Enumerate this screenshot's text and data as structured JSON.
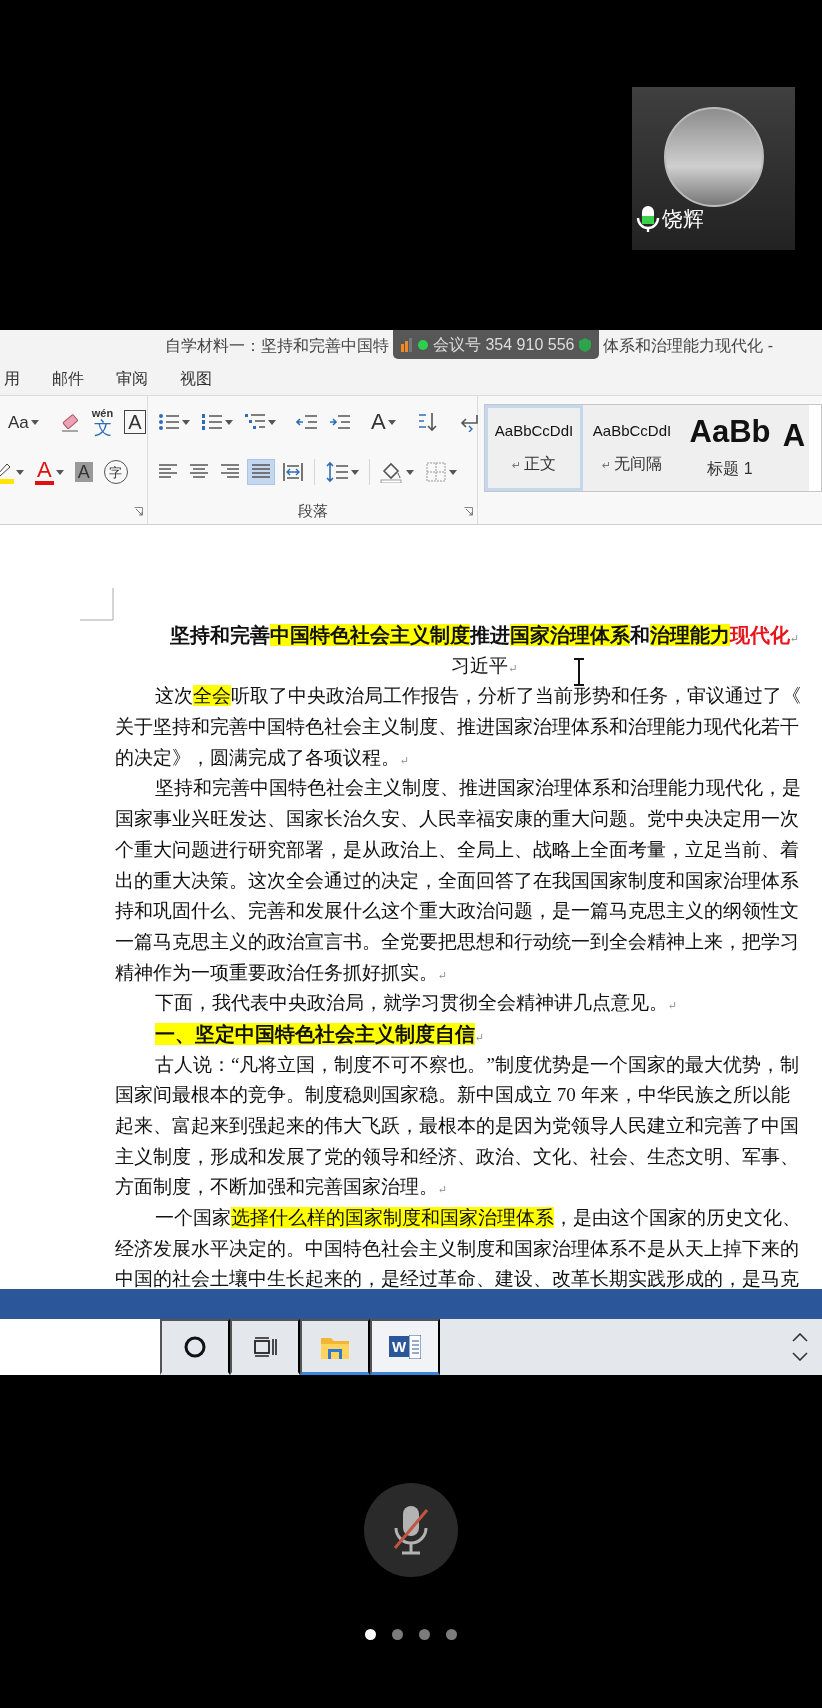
{
  "participant": {
    "name": "饶辉",
    "level": 0.5
  },
  "window": {
    "title_left": "自学材料一：坚持和完善中国特",
    "title_right": "体系和治理能力现代化 -"
  },
  "meeting_overlay": {
    "label": "会议号 354 910 556"
  },
  "menu_tabs": [
    {
      "label": "用"
    },
    {
      "label": "邮件"
    },
    {
      "label": "审阅"
    },
    {
      "label": "视图"
    }
  ],
  "font_group": {
    "row1": [
      {
        "kind": "font-size",
        "glyph": "Aa",
        "dropdown": true
      },
      {
        "kind": "separator"
      },
      {
        "kind": "eraser"
      },
      {
        "kind": "phonetic",
        "glyph": "文",
        "ruby": "wén"
      },
      {
        "kind": "boxed",
        "glyph": "A"
      }
    ],
    "row2": [
      {
        "kind": "highlighter",
        "dropdown": true
      },
      {
        "kind": "font-color",
        "glyph": "A",
        "dropdown": true
      },
      {
        "kind": "shaded",
        "glyph": "A"
      },
      {
        "kind": "circled",
        "glyph": "字"
      }
    ]
  },
  "paragraph_group": {
    "label": "段落",
    "row1": [
      {
        "kind": "bullets",
        "dropdown": true,
        "selected": false
      },
      {
        "kind": "numbering",
        "dropdown": true,
        "selected": false
      },
      {
        "kind": "multilevel",
        "dropdown": true,
        "selected": false
      },
      {
        "kind": "separator"
      },
      {
        "kind": "outdent",
        "selected": false
      },
      {
        "kind": "indent",
        "selected": false
      },
      {
        "kind": "separator"
      },
      {
        "kind": "asian-layout",
        "glyph": "A",
        "dropdown": true,
        "selected": false
      },
      {
        "kind": "separator"
      },
      {
        "kind": "sort",
        "selected": false
      },
      {
        "kind": "separator"
      },
      {
        "kind": "show-marks",
        "selected": false
      }
    ],
    "row2": [
      {
        "kind": "align-left",
        "selected": false
      },
      {
        "kind": "align-center",
        "selected": false
      },
      {
        "kind": "align-right",
        "selected": false
      },
      {
        "kind": "justify",
        "selected": true
      },
      {
        "kind": "distribute",
        "selected": false
      },
      {
        "kind": "separator"
      },
      {
        "kind": "line-spacing",
        "dropdown": true,
        "selected": false
      },
      {
        "kind": "separator"
      },
      {
        "kind": "shading",
        "dropdown": true,
        "selected": false
      },
      {
        "kind": "borders",
        "dropdown": true,
        "selected": false
      }
    ]
  },
  "styles": [
    {
      "sample": "AaBbCcDdI",
      "label": "正文",
      "mark": "↵",
      "kind": "body",
      "selected": true
    },
    {
      "sample": "AaBbCcDdI",
      "label": "无间隔",
      "mark": "↵",
      "kind": "body",
      "selected": false
    },
    {
      "sample": "AaBb",
      "label": "标题 1",
      "kind": "heading",
      "selected": false
    },
    {
      "sample": "A",
      "kind": "heading",
      "selected": false
    }
  ],
  "document": {
    "lines": [
      {
        "kind": "title",
        "runs": [
          {
            "text": "坚持和完善"
          },
          {
            "text": "中国特色社会主义制度",
            "highlight": true
          },
          {
            "text": "推进"
          },
          {
            "text": "国家治理体系",
            "highlight": true
          },
          {
            "text": "和"
          },
          {
            "text": "治理能力",
            "highlight": true
          },
          {
            "text": "现代化",
            "color": "#e8141b"
          }
        ],
        "mark": "↵"
      },
      {
        "kind": "byline",
        "runs": [
          {
            "text": "习近平"
          }
        ],
        "mark": "↵"
      },
      {
        "indent": true,
        "runs": [
          {
            "text": "这次"
          },
          {
            "text": "全会",
            "highlight": true
          },
          {
            "text": "听取了中央政治局工作报告，分析了当前形势和任务，审议通过了《"
          }
        ]
      },
      {
        "runs": [
          {
            "text": "关于坚持和完善中国特色社会主义制度、推进国家治理体系和治理能力现代化若干"
          }
        ]
      },
      {
        "runs": [
          {
            "text": "的决定》，圆满完成了各项议程。"
          }
        ],
        "mark": "↵"
      },
      {
        "indent": true,
        "runs": [
          {
            "text": "坚持和完善中国特色社会主义制度、推进国家治理体系和治理能力现代化，是"
          }
        ]
      },
      {
        "runs": [
          {
            "text": "国家事业兴旺发达、国家长治久安、人民幸福安康的重大问题。党中央决定用一次"
          }
        ]
      },
      {
        "runs": [
          {
            "text": "个重大问题进行研究部署，是从政治上、全局上、战略上全面考量，立足当前、着"
          }
        ]
      },
      {
        "runs": [
          {
            "text": "出的重大决策。这次全会通过的决定，全面回答了在我国国家制度和国家治理体系"
          }
        ]
      },
      {
        "runs": [
          {
            "text": "持和巩固什么、完善和发展什么这个重大政治问题，是一篇马克思主义的纲领性文"
          }
        ]
      },
      {
        "runs": [
          {
            "text": "一篇马克思主义的政治宣言书。全党要把思想和行动统一到全会精神上来，把学习"
          }
        ]
      },
      {
        "runs": [
          {
            "text": "精神作为一项重要政治任务抓好抓实。"
          }
        ],
        "mark": "↵"
      },
      {
        "indent": true,
        "runs": [
          {
            "text": "下面，我代表中央政治局，就学习贯彻全会精神讲几点意见。"
          }
        ],
        "mark": "↵"
      },
      {
        "kind": "heading",
        "indent": true,
        "runs": [
          {
            "text": "一、坚定中国特色社会主义制度自信",
            "highlight": true
          }
        ],
        "mark": "↵"
      },
      {
        "indent": true,
        "runs": [
          {
            "text": "古人说：“凡将立国，制度不可不察也。”制度优势是一个国家的最大优势，制"
          }
        ]
      },
      {
        "runs": [
          {
            "text": "国家间最根本的竞争。制度稳则国家稳。新中国成立 70 年来，中华民族之所以能"
          }
        ]
      },
      {
        "runs": [
          {
            "text": "起来、富起来到强起来的伟大飞跃，最根本的是因为党领导人民建立和完善了中国"
          }
        ]
      },
      {
        "runs": [
          {
            "text": "主义制度，形成和发展了党的领导和经济、政治、文化、社会、生态文明、军事、"
          }
        ]
      },
      {
        "runs": [
          {
            "text": "方面制度，不断加强和完善国家治理。"
          }
        ],
        "mark": "↵"
      },
      {
        "indent": true,
        "runs": [
          {
            "text": "一个国家"
          },
          {
            "text": "选择什么样的国家制度和国家治理体系",
            "highlight": true
          },
          {
            "text": "，是由这个国家的历史文化、"
          }
        ]
      },
      {
        "runs": [
          {
            "text": "经济发展水平决定的。中国特色社会主义制度和国家治理体系不是从天上掉下来的"
          }
        ]
      },
      {
        "runs": [
          {
            "text": "中国的社会土壤中生长起来的，是经过革命、建设、改革长期实践形成的，是马克"
          }
        ]
      }
    ]
  },
  "taskbar": {
    "items": [
      {
        "kind": "search-circle",
        "open": false,
        "selected": false
      },
      {
        "kind": "task-view",
        "open": false,
        "selected": false
      },
      {
        "kind": "file-explorer",
        "open": true,
        "selected": false
      },
      {
        "kind": "word",
        "glyph": "W",
        "open": true,
        "selected": true
      }
    ]
  },
  "call_controls": {
    "mic_muted": true,
    "pages": [
      {
        "selected": true
      },
      {
        "selected": false
      },
      {
        "selected": false
      },
      {
        "selected": false
      }
    ]
  }
}
